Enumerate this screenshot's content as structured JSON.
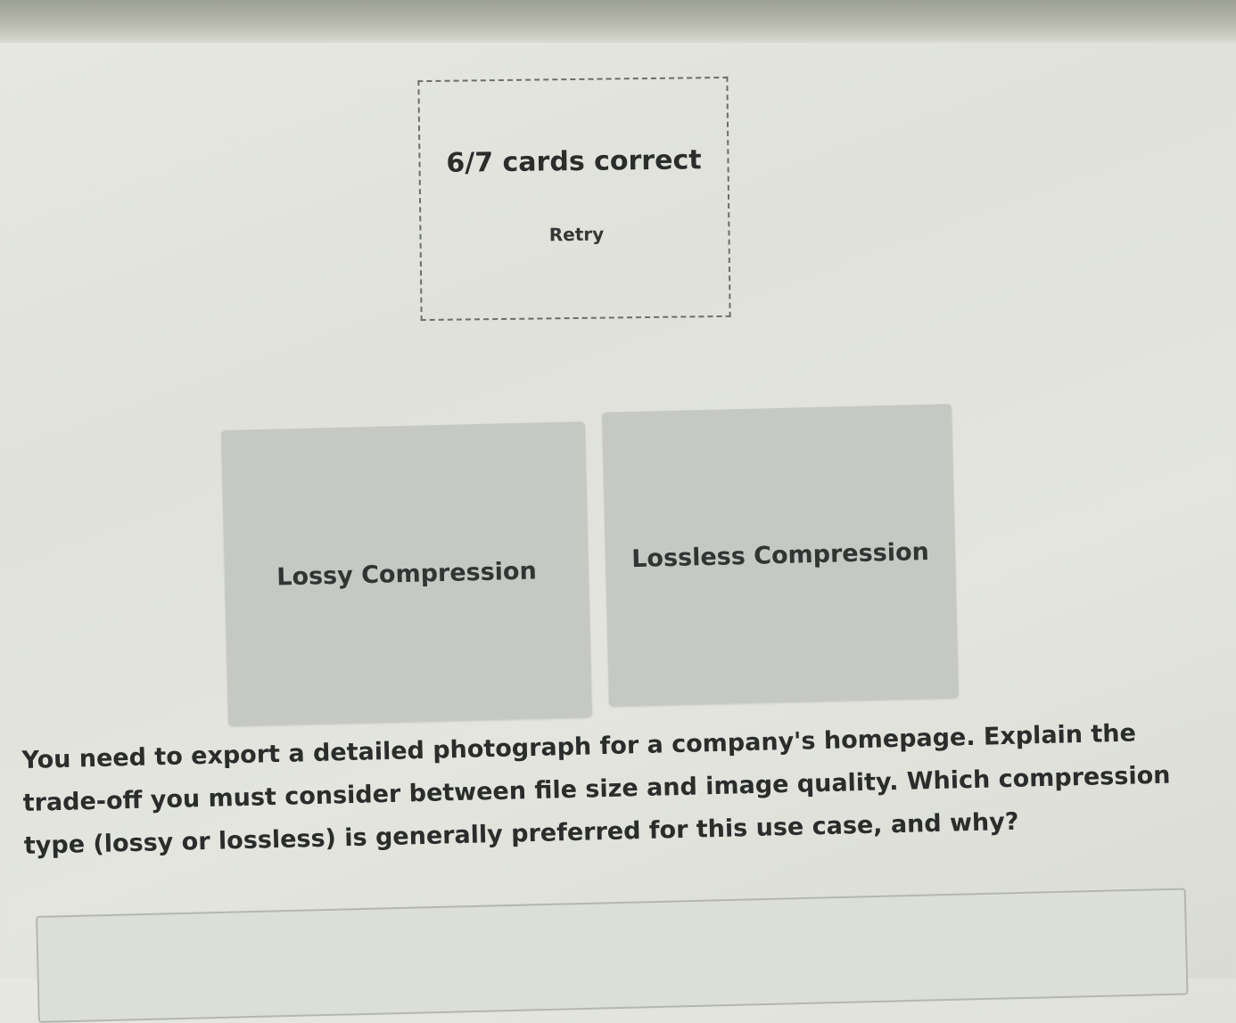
{
  "result": {
    "score_text": "6/7 cards correct",
    "retry_label": "Retry"
  },
  "cards": [
    {
      "label": "Lossy Compression"
    },
    {
      "label": "Lossless Compression"
    }
  ],
  "question": {
    "text": "You need to export a detailed photograph for a company's homepage. Explain the trade-off you must consider between file size and image quality. Which compression type (lossy or lossless) is generally preferred for this use case, and why?"
  },
  "answer": {
    "value": "",
    "placeholder": ""
  }
}
